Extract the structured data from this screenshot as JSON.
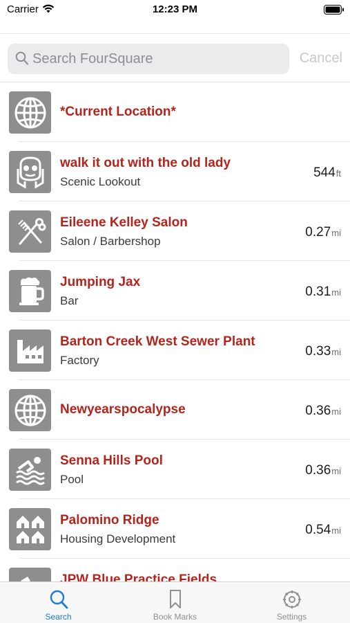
{
  "status_bar": {
    "carrier": "Carrier",
    "time": "12:23 PM"
  },
  "search": {
    "placeholder": "Search FourSquare",
    "value": "",
    "cancel_label": "Cancel"
  },
  "colors": {
    "title_red": "#b4241c",
    "tab_active": "#1a7cd9",
    "tile_gray": "#8e8e8e"
  },
  "results": [
    {
      "title": "*Current Location*",
      "subtitle": "",
      "distance": "",
      "unit": "",
      "icon": "globe-icon"
    },
    {
      "title": "walk it out with the old lady",
      "subtitle": "Scenic Lookout",
      "distance": "544",
      "unit": "ft",
      "icon": "scenic-lookout-icon"
    },
    {
      "title": "Eileene Kelley Salon",
      "subtitle": "Salon / Barbershop",
      "distance": "0.27",
      "unit": "mi",
      "icon": "salon-icon"
    },
    {
      "title": "Jumping Jax",
      "subtitle": "Bar",
      "distance": "0.31",
      "unit": "mi",
      "icon": "beer-mug-icon"
    },
    {
      "title": "Barton Creek West Sewer Plant",
      "subtitle": "Factory",
      "distance": "0.33",
      "unit": "mi",
      "icon": "factory-icon"
    },
    {
      "title": "Newyearspocalypse",
      "subtitle": "",
      "distance": "0.36",
      "unit": "mi",
      "icon": "globe-icon"
    },
    {
      "title": "Senna Hills Pool",
      "subtitle": "Pool",
      "distance": "0.36",
      "unit": "mi",
      "icon": "pool-icon"
    },
    {
      "title": "Palomino Ridge",
      "subtitle": "Housing Development",
      "distance": "0.54",
      "unit": "mi",
      "icon": "housing-icon"
    },
    {
      "title": "JPW Blue Practice Fields",
      "subtitle": "",
      "distance": "",
      "unit": "",
      "icon": "field-icon"
    }
  ],
  "tab_bar": {
    "tabs": [
      {
        "label": "Search",
        "icon": "search-icon",
        "active": true
      },
      {
        "label": "Book Marks",
        "icon": "bookmark-icon",
        "active": false
      },
      {
        "label": "Settings",
        "icon": "settings-icon",
        "active": false
      }
    ]
  }
}
